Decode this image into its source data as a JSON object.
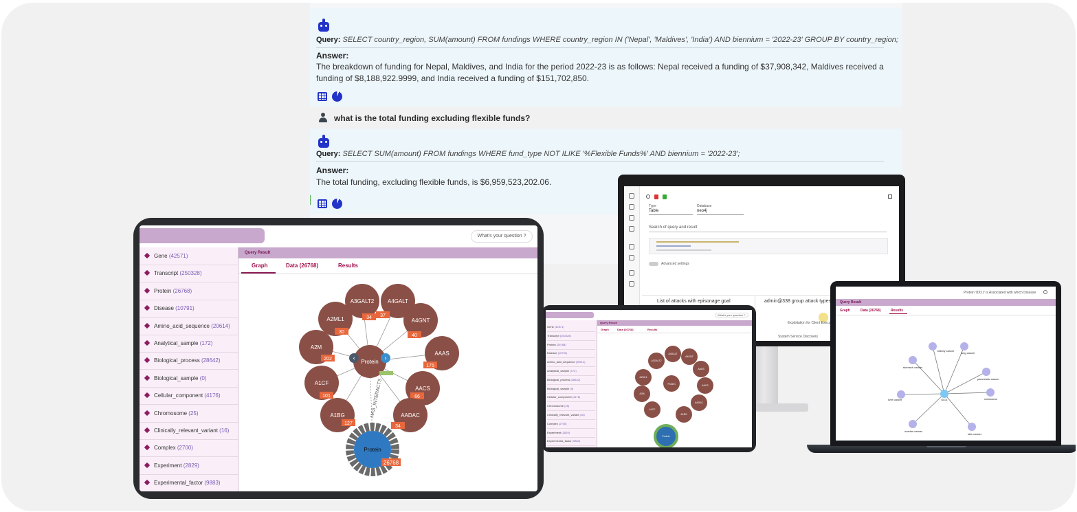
{
  "chat": {
    "query1": {
      "label": "Query:",
      "sql": "SELECT country_region, SUM(amount) FROM fundings WHERE country_region IN ('Nepal', 'Maldives', 'India') AND biennium = '2022-23' GROUP BY country_region;"
    },
    "answer1": {
      "label": "Answer:",
      "text": "The breakdown of funding for Nepal, Maldives, and India for the period 2022-23 is as follows: Nepal received a funding of $37,908,342, Maldives received a funding of $8,188,922.9999, and India received a funding of $151,702,850."
    },
    "user_question": "what is the total funding excluding flexible funds?",
    "query2": {
      "label": "Query:",
      "sql": "SELECT SUM(amount) FROM fundings WHERE fund_type NOT ILIKE '%Flexible Funds%' AND biennium = '2022-23';"
    },
    "answer2": {
      "label": "Answer:",
      "text": "The total funding, excluding flexible funds, is $6,959,523,202.06."
    }
  },
  "monitor": {
    "type_label": "Type",
    "type_value": "Table",
    "database_label": "Database",
    "database_value": "neo4j",
    "search_placeholder": "Search of query and result",
    "advanced_settings": "Advanced settings",
    "panel1_title": "List of attacks with episonage goal",
    "panel2_title": "admin@338 group attack types",
    "graph_label_1": "Exploitation for Client Execution",
    "graph_label_2": "System Service Discovery"
  },
  "laptop": {
    "header_text": "Protein 'IDO1' is Associated with which Disease",
    "bar_title": "Query Result",
    "tabs": [
      "Graph",
      "Data (26768)",
      "Results"
    ],
    "center": "IDO1",
    "diseases": [
      "kidney cancer",
      "lung cancer",
      "stomach cancer",
      "pancreatic cancer",
      "liver cancer",
      "melanoma",
      "ovarian cancer",
      "skin cancer"
    ]
  },
  "tablet": {
    "search": "What's your question ?",
    "query_result": "Query Result",
    "tabs": {
      "graph": "Graph",
      "data": "Data",
      "data_count": "(26768)",
      "results": "Results"
    },
    "sidebar": [
      {
        "label": "Gene",
        "count": "(42571)"
      },
      {
        "label": "Transcript",
        "count": "(250328)"
      },
      {
        "label": "Protein",
        "count": "(26768)"
      },
      {
        "label": "Disease",
        "count": "(10791)"
      },
      {
        "label": "Amino_acid_sequence",
        "count": "(20614)"
      },
      {
        "label": "Analytical_sample",
        "count": "(172)"
      },
      {
        "label": "Biological_process",
        "count": "(28642)"
      },
      {
        "label": "Biological_sample",
        "count": "(0)"
      },
      {
        "label": "Cellular_component",
        "count": "(4176)"
      },
      {
        "label": "Chromosome",
        "count": "(25)"
      },
      {
        "label": "Clinically_relevant_variant",
        "count": "(16)"
      },
      {
        "label": "Complex",
        "count": "(2700)"
      },
      {
        "label": "Experiment",
        "count": "(2829)"
      },
      {
        "label": "Experimental_factor",
        "count": "(9883)"
      }
    ],
    "graph": {
      "center": "Protein",
      "hub": "Protein",
      "hub_badge": "26768",
      "edge_label": "HAS_INTERACTS",
      "nodes": [
        {
          "label": "A3GALT2",
          "badge": "34"
        },
        {
          "label": "A4GALT",
          "badge": "37"
        },
        {
          "label": "A4GNT",
          "badge": "40"
        },
        {
          "label": "AAAS",
          "badge": "175"
        },
        {
          "label": "AACS",
          "badge": "66"
        },
        {
          "label": "AADAC",
          "badge": "34"
        },
        {
          "label": "A1BG",
          "badge": "127"
        },
        {
          "label": "A1CF",
          "badge": "101"
        },
        {
          "label": "A2M",
          "badge": "202"
        },
        {
          "label": "A2ML1",
          "badge": "30"
        }
      ]
    }
  },
  "colors": {
    "accent_purple": "#c8a9cd",
    "tab_red": "#a2114d",
    "node_brown": "#8a5047",
    "badge_orange": "#e8673c",
    "bot_blue": "#2233c9"
  }
}
